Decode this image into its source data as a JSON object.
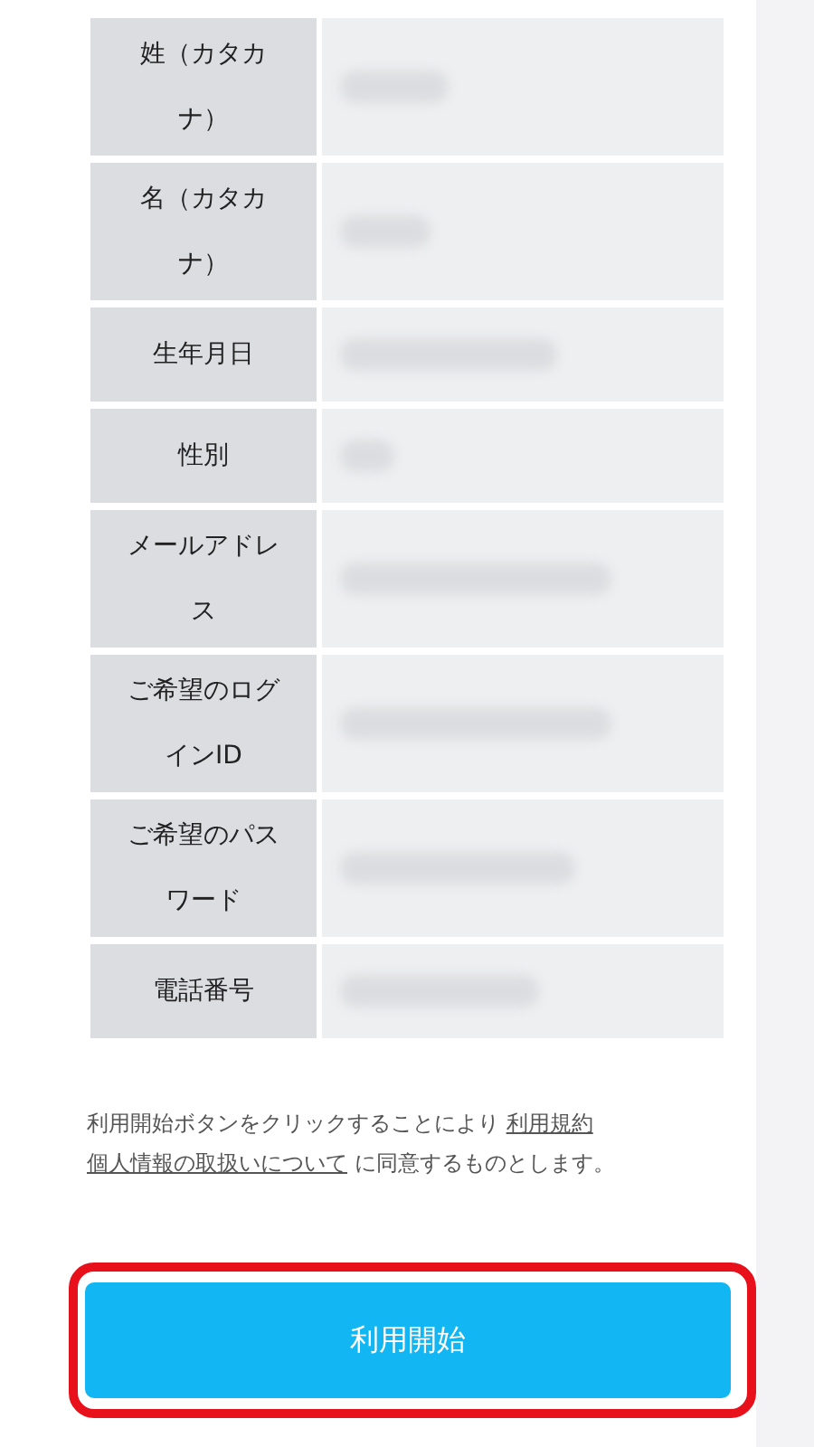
{
  "table": {
    "rows": [
      {
        "label": "姓（カタカナ）"
      },
      {
        "label": "名（カタカナ）"
      },
      {
        "label": "生年月日"
      },
      {
        "label": "性別"
      },
      {
        "label": "メールアドレス"
      },
      {
        "label": "ご希望のログインID"
      },
      {
        "label": "ご希望のパスワード"
      },
      {
        "label": "電話番号"
      }
    ]
  },
  "consent": {
    "before": "利用開始ボタンをクリックすることにより",
    "links": [
      "利用規約",
      "個人情報の取扱いについて"
    ],
    "after": "に同意するものとします。"
  },
  "submit_button": {
    "label": "利用開始"
  }
}
